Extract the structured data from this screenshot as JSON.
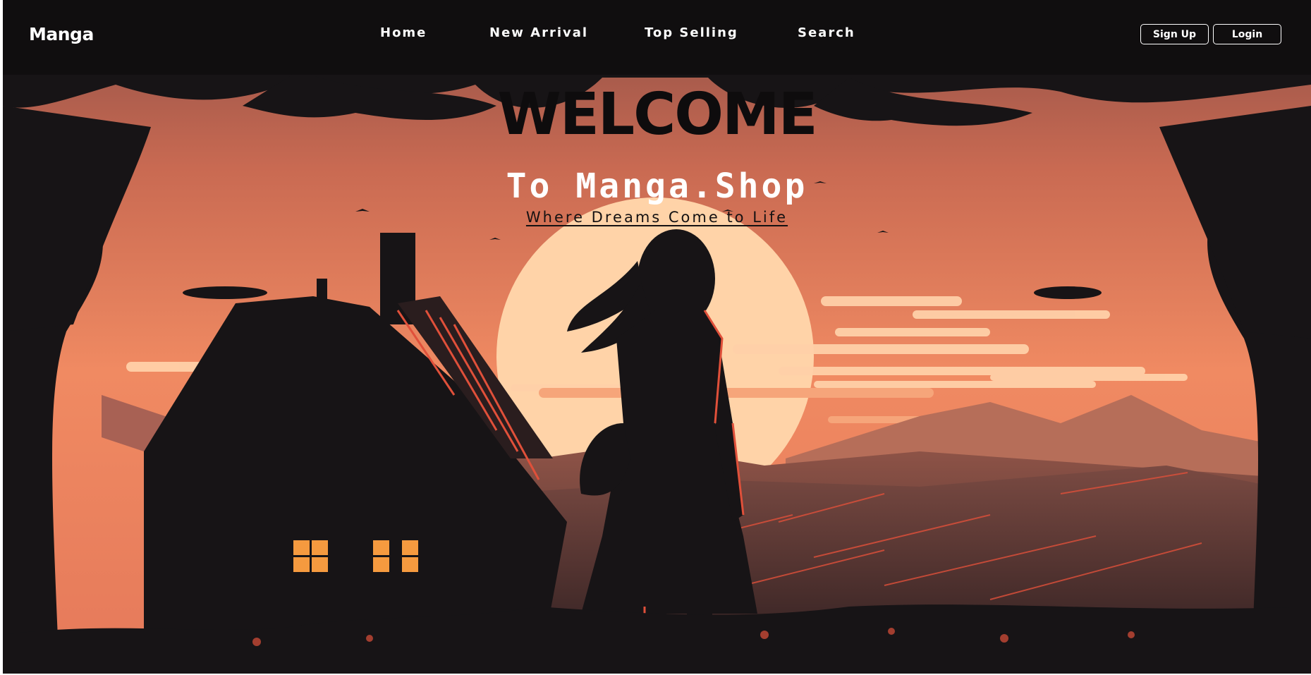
{
  "brand": {
    "name": "Manga"
  },
  "nav": {
    "items": [
      {
        "label": "Home"
      },
      {
        "label": "New Arrival"
      },
      {
        "label": "Top Selling"
      },
      {
        "label": "Search"
      }
    ]
  },
  "auth": {
    "signup_label": "Sign Up",
    "login_label": "Login"
  },
  "hero": {
    "title": "WELCOME",
    "subtitle": "To Manga.Shop",
    "tagline": "Where Dreams Come to Life",
    "illustration": "sunset-anime-girl-cottage-illustration"
  },
  "colors": {
    "nav_bg": "#100e0f",
    "sky_top": "#b5604f",
    "sky_bottom": "#f08a62",
    "sun": "#ffd3a8",
    "silhouette": "#171416",
    "window_glow": "#f59a3f",
    "accent_red": "#e0503a"
  }
}
